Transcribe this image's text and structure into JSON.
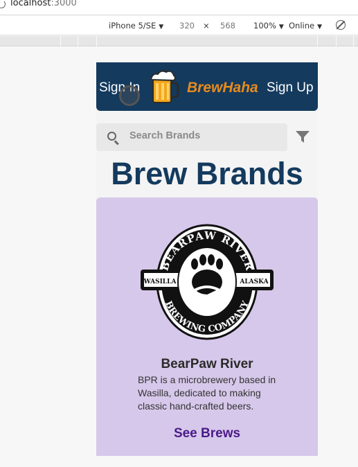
{
  "browser": {
    "url_host": "localhost",
    "url_port": ":3000"
  },
  "devtools": {
    "device": "iPhone 5/SE",
    "width": "320",
    "times": "×",
    "height": "568",
    "zoom": "100%",
    "network": "Online"
  },
  "navbar": {
    "signin_label": "Sign In",
    "brand": "BrewHaha",
    "signup_label": "Sign Up",
    "logo_icon": "beer-mug-icon",
    "bg_color": "#143a5e",
    "brand_color": "#e88b1c"
  },
  "search": {
    "placeholder": "Search Brands",
    "value": ""
  },
  "page": {
    "title": "Brew Brands"
  },
  "card": {
    "name": "BearPaw River",
    "description": "BPR is a microbrewery based in Wasilla, dedicated to making classic hand-crafted beers.",
    "link_label": "See Brews",
    "bg_color": "#d6c8ea",
    "logo": {
      "top_text": "BEARPAW RIVER",
      "bottom_text": "BREWING COMPANY",
      "left_text": "WASILLA",
      "right_text": "ALASKA"
    }
  }
}
